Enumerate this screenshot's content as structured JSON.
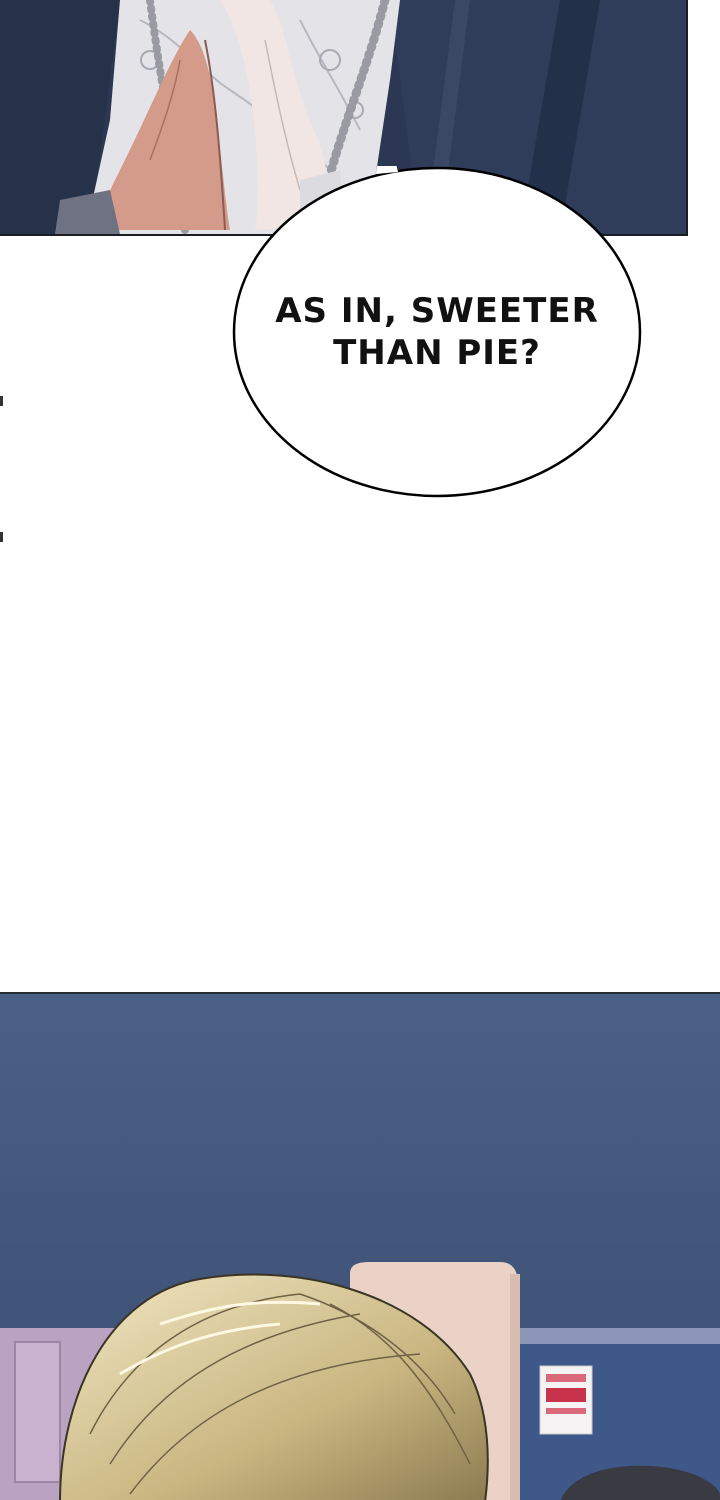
{
  "speech_bubble": {
    "text": "AS IN, SWEETER\nTHAN PIE?"
  },
  "colors": {
    "suit_navy": "#2e3a55",
    "wall_blue": "#4a5f86",
    "skin": "#d9a596",
    "lace_white": "#e6e6ea",
    "hair_blonde": "#d9c99a",
    "bubble_stroke": "#000000"
  }
}
